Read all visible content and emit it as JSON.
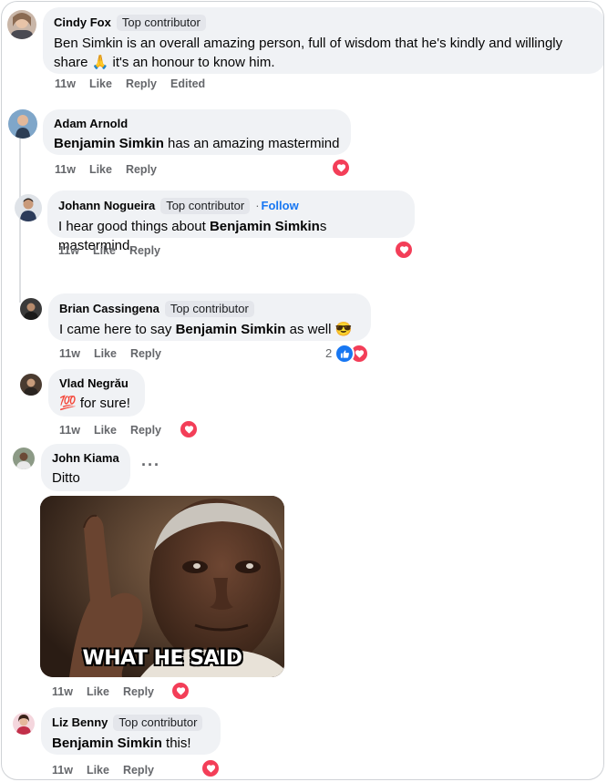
{
  "colors": {
    "bubble": "#f0f2f5",
    "heart": "#f33e58",
    "like": "#1877f2",
    "meta": "#65676b"
  },
  "comments": [
    {
      "author": "Cindy Fox",
      "badge": "Top contributor",
      "text_line1": "Ben Simkin is an overall amazing person, full of wisdom that he's kindly and willingly",
      "text_line2": "share 🙏 it's an honour to know him.",
      "time": "11w",
      "like": "Like",
      "reply": "Reply",
      "edited": "Edited"
    },
    {
      "author": "Adam Arnold",
      "mention": "Benjamin Simkin",
      "text_rest": " has an amazing mastermind",
      "time": "11w",
      "like": "Like",
      "reply": "Reply"
    },
    {
      "author": "Johann Nogueira",
      "badge": "Top contributor",
      "separator": "·",
      "follow": "Follow",
      "text_pre": "I hear good things about ",
      "mention": "Benjamin Simkin",
      "text_rest": "s mastermind.",
      "time": "11w",
      "like": "Like",
      "reply": "Reply"
    },
    {
      "author": "Brian Cassingena",
      "badge": "Top contributor",
      "text_pre": "I came here to say ",
      "mention": "Benjamin Simkin",
      "text_rest": " as well 😎",
      "reaction_count": "2",
      "time": "11w",
      "like": "Like",
      "reply": "Reply"
    },
    {
      "author": "Vlad Negrău",
      "text": "💯 for sure!",
      "time": "11w",
      "like": "Like",
      "reply": "Reply"
    },
    {
      "author": "John Kiama",
      "text": "Ditto",
      "more": "···",
      "meme_caption": "WHAT HE SAID",
      "time": "11w",
      "like": "Like",
      "reply": "Reply"
    },
    {
      "author": "Liz Benny",
      "badge": "Top contributor",
      "mention": "Benjamin Simkin",
      "text_rest": " this!",
      "time": "11w",
      "like": "Like",
      "reply": "Reply"
    }
  ]
}
